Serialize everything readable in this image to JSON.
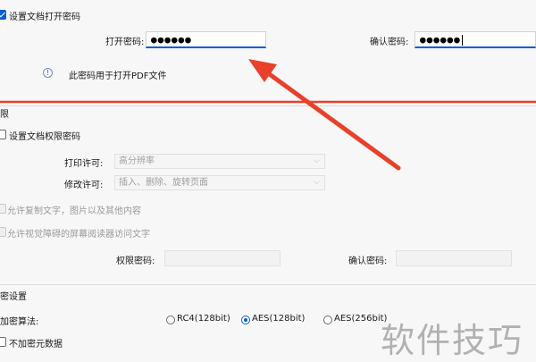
{
  "open_password_section": {
    "checkbox_label": "设置文档打开密码",
    "open_password_label": "打开密码:",
    "open_password_value": "●●●●●●",
    "confirm_password_label": "确认密码:",
    "confirm_password_value": "●●●●●●",
    "info_text": "此密码用于打开PDF文件"
  },
  "permissions_section": {
    "header": "限",
    "checkbox_label": "设置文档权限密码",
    "print_label": "打印许可:",
    "print_value": "高分辨率",
    "modify_label": "修改许可:",
    "modify_value": "插入、删除、旋转页面",
    "allow_copy_label": "允许复制文字，图片以及其他内容",
    "allow_screenreader_label": "允许视觉障碍的屏幕阅读器访问文字",
    "perm_password_label": "权限密码:",
    "perm_confirm_label": "确认密码:"
  },
  "encryption_section": {
    "header": "密设置",
    "algorithm_label": "加密算法:",
    "options": [
      "RC4(128bit)",
      "AES(128bit)",
      "AES(256bit)"
    ],
    "selected": "AES(128bit)",
    "no_metadata_label": "不加密元数据"
  },
  "annotation_color": "#e8402a",
  "watermark_text": "软件技巧"
}
